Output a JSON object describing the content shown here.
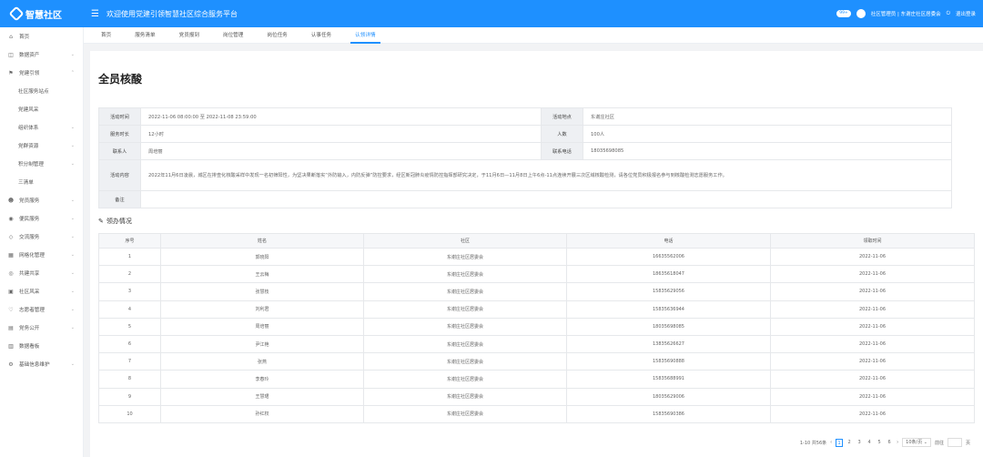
{
  "header": {
    "logo": "智慧社区",
    "title": "欢迎使用党建引领智慧社区综合服务平台",
    "msg_badge": "99+",
    "user": "社区管理员 | 东谢庄社区居委会",
    "logout": "退出登录"
  },
  "sidebar": {
    "items": [
      {
        "label": "首页",
        "icon": "home-icon",
        "glyph": "⌂",
        "chev": ""
      },
      {
        "label": "数据资产",
        "icon": "data-icon",
        "glyph": "◫",
        "chev": "⌄"
      },
      {
        "label": "党建引领",
        "icon": "flag-icon",
        "glyph": "⚑",
        "chev": "⌃"
      },
      {
        "label": "社区服务站点",
        "sub": true,
        "chev": ""
      },
      {
        "label": "党建风采",
        "sub": true,
        "chev": ""
      },
      {
        "label": "组织体系",
        "sub": true,
        "chev": "⌄"
      },
      {
        "label": "党群资源",
        "sub": true,
        "chev": "⌄"
      },
      {
        "label": "积分制管理",
        "sub": true,
        "chev": "⌄"
      },
      {
        "label": "三清单",
        "sub": true,
        "chev": ""
      },
      {
        "label": "党员服务",
        "icon": "people-icon",
        "glyph": "☻",
        "chev": "⌄"
      },
      {
        "label": "便民服务",
        "icon": "service-icon",
        "glyph": "◉",
        "chev": "⌄"
      },
      {
        "label": "交流服务",
        "icon": "chat-icon",
        "glyph": "◇",
        "chev": "⌄"
      },
      {
        "label": "网格化管理",
        "icon": "grid-icon",
        "glyph": "▦",
        "chev": "⌄"
      },
      {
        "label": "共建共享",
        "icon": "share-icon",
        "glyph": "◎",
        "chev": "⌄"
      },
      {
        "label": "社区风采",
        "icon": "image-icon",
        "glyph": "▣",
        "chev": "⌄"
      },
      {
        "label": "志愿者管理",
        "icon": "volunteer-icon",
        "glyph": "♡",
        "chev": "⌄"
      },
      {
        "label": "党务公开",
        "icon": "notice-icon",
        "glyph": "▤",
        "chev": "⌄"
      },
      {
        "label": "数据看板",
        "icon": "chart-icon",
        "glyph": "▥",
        "chev": ""
      },
      {
        "label": "基础信息维护",
        "icon": "settings-icon",
        "glyph": "⚙",
        "chev": "⌄"
      }
    ]
  },
  "tabs": [
    {
      "label": "首页",
      "active": false
    },
    {
      "label": "服务清单",
      "active": false
    },
    {
      "label": "党员报到",
      "active": false
    },
    {
      "label": "岗位管理",
      "active": false
    },
    {
      "label": "岗位任务",
      "active": false
    },
    {
      "label": "认事任务",
      "active": false
    },
    {
      "label": "认领详情",
      "active": true
    }
  ],
  "page_title": "全员核酸",
  "info": {
    "activity_time_label": "活动时间",
    "activity_time": "2022-11-06 08:00:00 至 2022-11-08 23:59:00",
    "location_label": "活动地点",
    "location": "东谢庄社区",
    "duration_label": "服务时长",
    "duration": "12小时",
    "count_label": "人数",
    "count": "100人",
    "contact_label": "联系人",
    "contact": "周培丽",
    "phone_label": "联系电话",
    "phone": "18035698085",
    "content_label": "活动内容",
    "content": "2022年11月6日凌晨，城区在排查化核酸采样中发现一名初筛阳性，为坚决果断落实“外防输入，内防反弹”防控要求，经区新冠肺炎疫情防控指挥部研究决定，于11月6日—11月8日上午6点-11点连续开展三次区域核酸检测，请各位党员积极报名参与到核酸检测志愿服务工作。",
    "remark_label": "备注",
    "remark": ""
  },
  "section_title": "领办情况",
  "table": {
    "headers": [
      "序号",
      "姓名",
      "社区",
      "电话",
      "领取时间"
    ],
    "rows": [
      [
        "1",
        "郭晓阳",
        "东谢庄社区居委会",
        "16635562006",
        "2022-11-06"
      ],
      [
        "2",
        "王云梅",
        "东谢庄社区居委会",
        "18635618047",
        "2022-11-06"
      ],
      [
        "3",
        "张慧枝",
        "东谢庄社区居委会",
        "15835629056",
        "2022-11-06"
      ],
      [
        "4",
        "刘利君",
        "东谢庄社区居委会",
        "15835636944",
        "2022-11-06"
      ],
      [
        "5",
        "周培丽",
        "东谢庄社区居委会",
        "18035698085",
        "2022-11-06"
      ],
      [
        "6",
        "尹江艳",
        "东谢庄社区居委会",
        "13835626627",
        "2022-11-06"
      ],
      [
        "7",
        "张燕",
        "东谢庄社区居委会",
        "15835690888",
        "2022-11-06"
      ],
      [
        "8",
        "李春玲",
        "东谢庄社区居委会",
        "15835688991",
        "2022-11-06"
      ],
      [
        "9",
        "王慧珺",
        "东谢庄社区居委会",
        "18035629006",
        "2022-11-06"
      ],
      [
        "10",
        "孙红权",
        "东谢庄社区居委会",
        "15835690386",
        "2022-11-06"
      ]
    ]
  },
  "pager": {
    "summary": "1-10 共56条",
    "prev": "‹",
    "pages": [
      "1",
      "2",
      "3",
      "4",
      "5",
      "6"
    ],
    "active_page": "1",
    "next": "›",
    "page_size": "10条/页 ⌄",
    "jump_label": "前往",
    "jump_suffix": "页"
  }
}
